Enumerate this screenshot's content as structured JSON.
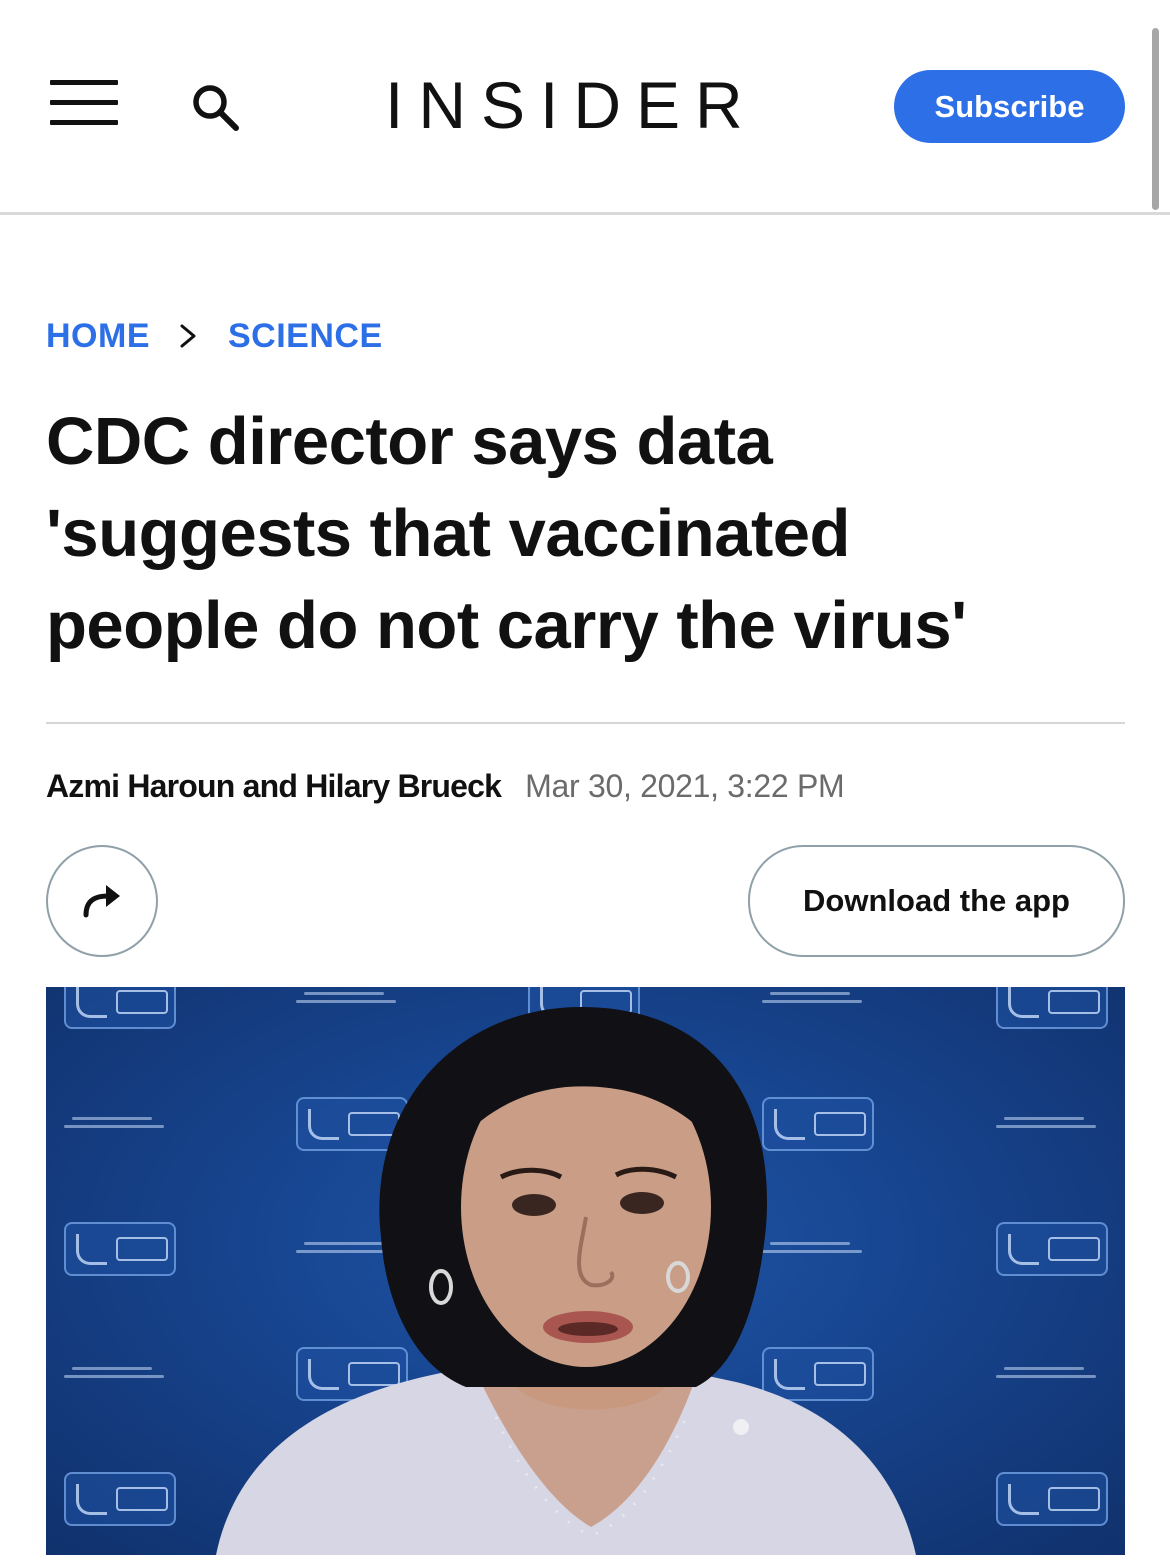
{
  "header": {
    "logo": "INSIDER",
    "subscribe_label": "Subscribe",
    "menu_icon": "hamburger-menu-icon",
    "search_icon": "search-icon"
  },
  "breadcrumb": {
    "items": [
      "HOME",
      "SCIENCE"
    ],
    "separator_icon": "chevron-right-icon"
  },
  "article": {
    "headline_lines": [
      "CDC director says data",
      "'suggests that vaccinated",
      "people do not carry the virus'"
    ],
    "authors": "Azmi Haroun and Hilary Brueck",
    "date": "Mar 30, 2021, 3:22 PM"
  },
  "actions": {
    "share_icon": "share-arrow-icon",
    "download_label": "Download the app"
  },
  "hero": {
    "image_subject": "person speaking in front of blue CDC logo backdrop"
  },
  "colors": {
    "accent": "#2d6fe6",
    "text": "#111111",
    "muted": "#6b6b6b",
    "divider": "#d9d9d9",
    "backdrop_blue": "#17448e"
  }
}
